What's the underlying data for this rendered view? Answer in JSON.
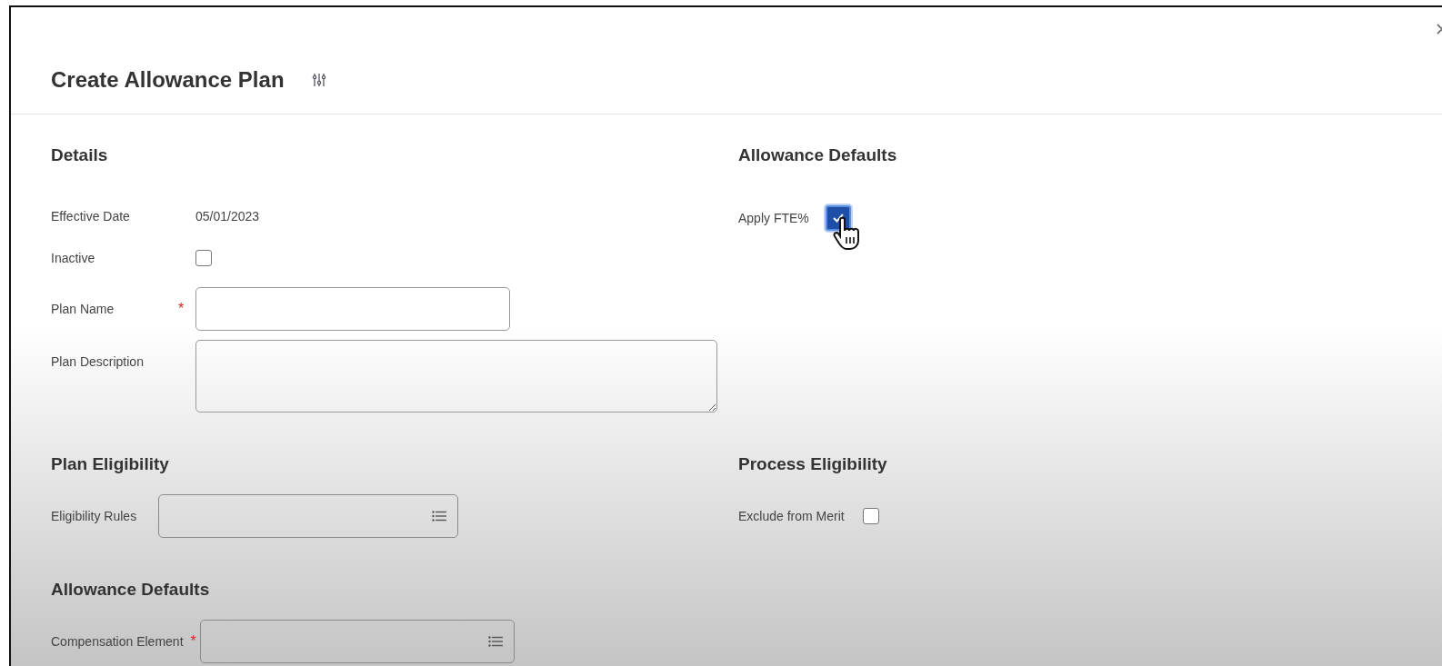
{
  "title": "Create Allowance Plan",
  "rows": [
    {
      "left": [
        {
          "heading": "Details",
          "fields": [
            {
              "kind": "text",
              "label": "Effective Date",
              "value": "05/01/2023"
            },
            {
              "kind": "checkbox",
              "label": "Inactive",
              "checked": false
            },
            {
              "kind": "input",
              "label": "Plan Name",
              "required_mark": "*"
            },
            {
              "kind": "textarea",
              "label": "Plan Description"
            }
          ]
        }
      ],
      "right": [
        {
          "heading": "Allowance Defaults",
          "fields": [
            {
              "kind": "checkbox",
              "label": "Apply FTE%",
              "checked": true,
              "focused": true
            }
          ]
        }
      ]
    },
    {
      "left": [
        {
          "heading": "Plan Eligibility",
          "fields": [
            {
              "kind": "prompt",
              "label": "Eligibility Rules"
            }
          ]
        },
        {
          "heading": "Allowance Defaults",
          "fields": [
            {
              "kind": "prompt",
              "label": "Compensation Element",
              "required_mark": "*"
            }
          ]
        }
      ],
      "right": [
        {
          "heading": "Process Eligibility",
          "fields": [
            {
              "kind": "checkbox",
              "label": "Exclude from Merit",
              "checked": false
            }
          ]
        }
      ]
    }
  ]
}
